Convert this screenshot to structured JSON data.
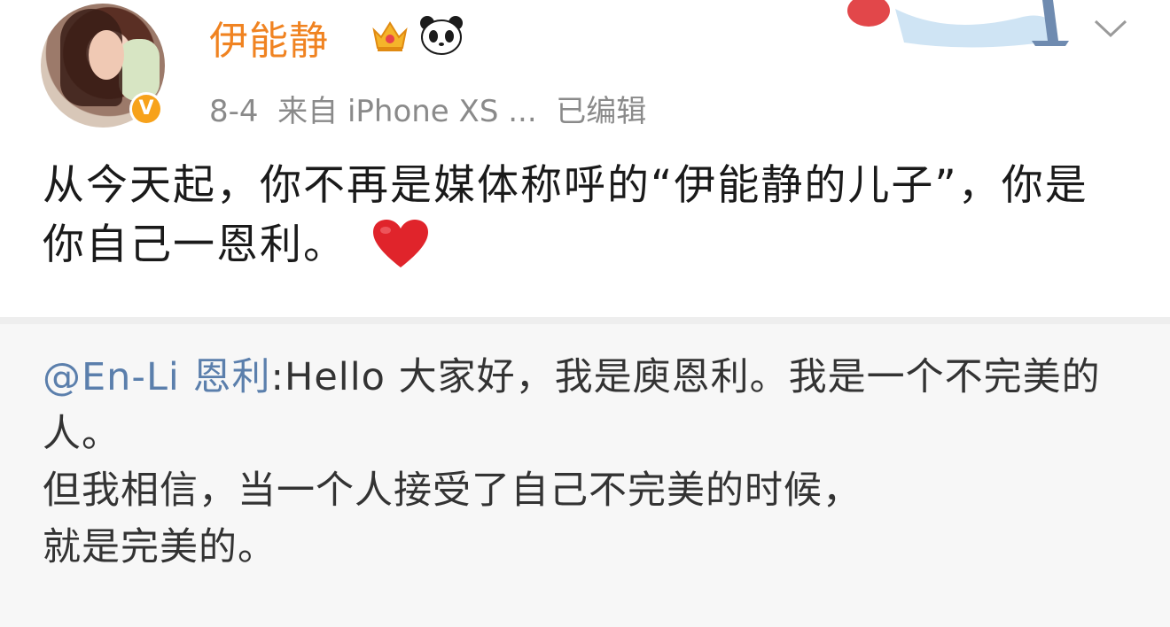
{
  "post": {
    "username": "伊能静",
    "meta": "8-4  来自 iPhone XS ...  已编辑",
    "text": "从今天起，你不再是媒体称呼的“伊能静的儿子”，你是你自己一恩利。",
    "badge_letter": "V",
    "icons": [
      "vip-crown-icon",
      "panda-icon",
      "verified-badge-icon",
      "heart-icon",
      "chevron-down-icon"
    ]
  },
  "repost": {
    "mention": "@En-Li 恩利",
    "line1_rest": ":Hello 大家好，我是庾恩利。我是一个不完美的人。",
    "line2": "但我相信，当一个人接受了自己不完美的时候，",
    "line3": "就是完美的。"
  },
  "colors": {
    "username": "#f08321",
    "mention": "#5b7fac",
    "meta": "#8a8a8a",
    "repost_bg": "#f7f7f7",
    "verified": "#f7a21b",
    "heart": "#e0242b"
  }
}
